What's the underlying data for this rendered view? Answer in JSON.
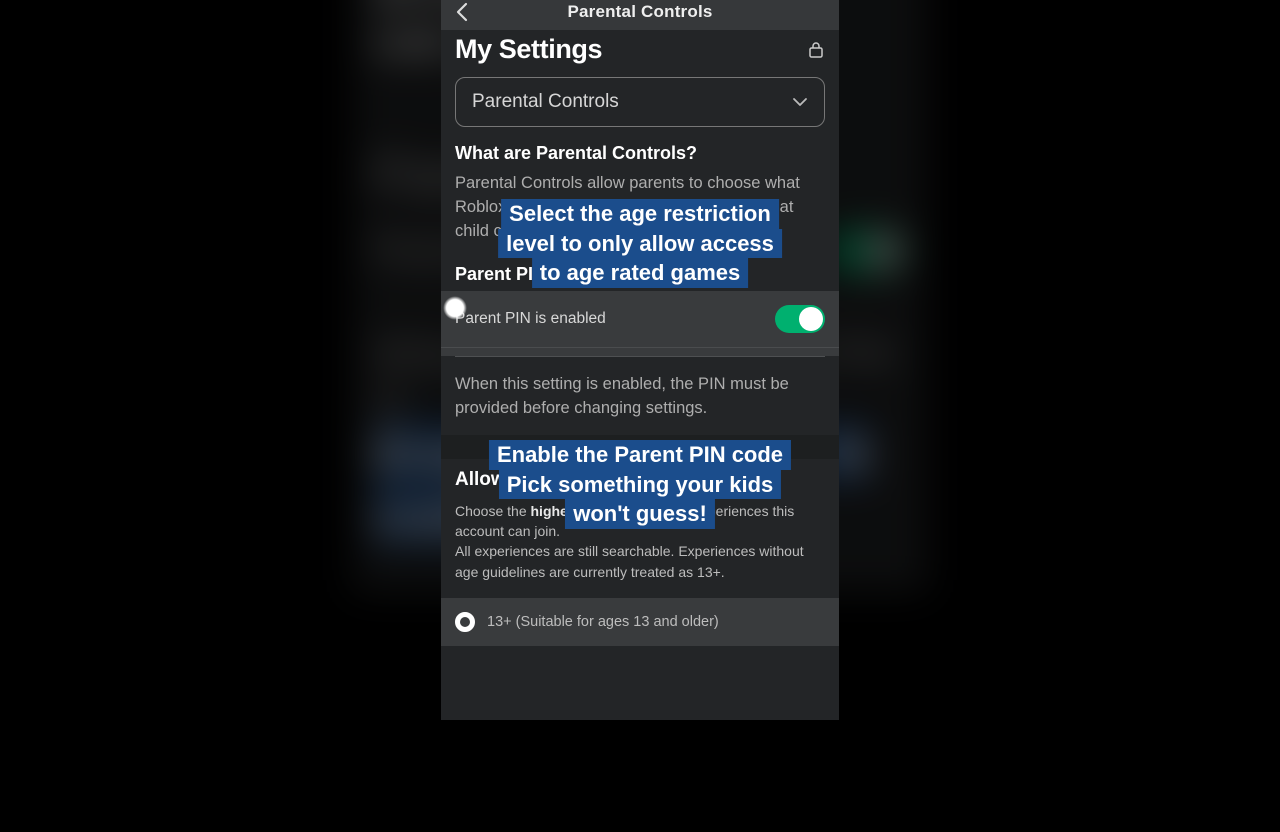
{
  "titlebar": {
    "title": "Parental Controls"
  },
  "page_title": "My Settings",
  "dropdown": {
    "label": "Parental Controls"
  },
  "what_heading": "What are Parental Controls?",
  "what_body": "Parental Controls allow parents to choose what Roblox features will continue to exist and what child can access them.",
  "parent_pin": {
    "heading": "Parent PIN",
    "row_label": "Parent PIN is enabled",
    "info": "When this setting is enabled, the PIN must be provided before changing settings."
  },
  "allowed": {
    "heading": "Allowed Experiences",
    "desc_pre": "Choose the ",
    "desc_bold": "highest age guideline",
    "desc_post": " of experiences this account can join.",
    "desc_line2": "All experiences are still searchable. Experiences without age guidelines are currently treated as 13+.",
    "option1": "13+ (Suitable for ages 13 and older)"
  },
  "overlays": {
    "o1": {
      "l1": "Select the age restriction",
      "l2": "level to only allow access",
      "l3": "to age rated games"
    },
    "o2": {
      "l1": "Enable the Parent PIN code",
      "l2": "Pick something your kids",
      "l3": "won't guess!"
    }
  }
}
